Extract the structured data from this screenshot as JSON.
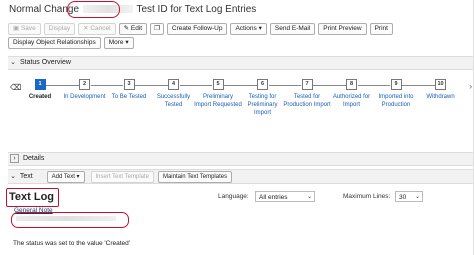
{
  "header": {
    "title_prefix": "Normal Change",
    "title_suffix": "Test ID for Text Log Entries"
  },
  "toolbar": {
    "row1": [
      {
        "label": "Save",
        "icon": "save-icon",
        "enabled": false
      },
      {
        "label": "Display",
        "enabled": false
      },
      {
        "label": "Cancel",
        "icon": "cancel-icon",
        "enabled": false
      },
      {
        "label": "Edit",
        "icon": "edit-icon",
        "enabled": true
      },
      {
        "label": "",
        "icon": "copy-icon",
        "enabled": true
      },
      {
        "label": "Create Follow-Up",
        "enabled": true
      },
      {
        "label": "Actions",
        "dropdown": true,
        "enabled": true
      },
      {
        "label": "Send E-Mail",
        "enabled": true
      },
      {
        "label": "Print Preview",
        "enabled": true
      },
      {
        "label": "Print",
        "enabled": true
      }
    ],
    "row2": [
      {
        "label": "Display Object Relationships",
        "enabled": true
      },
      {
        "label": "More",
        "dropdown": true,
        "enabled": true
      }
    ]
  },
  "status_overview": {
    "title": "Status Overview",
    "steps": [
      {
        "num": "1",
        "label": "Created",
        "active": true
      },
      {
        "num": "2",
        "label": "In Development"
      },
      {
        "num": "3",
        "label": "To Be Tested"
      },
      {
        "num": "4",
        "label": "Successfully Tested"
      },
      {
        "num": "5",
        "label": "Preliminary Import Requested"
      },
      {
        "num": "6",
        "label": "Testing for Preliminary Import"
      },
      {
        "num": "7",
        "label": "Tested for Production Import"
      },
      {
        "num": "8",
        "label": "Authorized for Import"
      },
      {
        "num": "9",
        "label": "Imported into Production"
      },
      {
        "num": "10",
        "label": "Withdrawn"
      }
    ]
  },
  "details": {
    "title": "Details"
  },
  "text_section": {
    "title": "Text",
    "add_text": "Add Text",
    "insert_template": "Insert Text Template",
    "maintain_templates": "Maintain Text Templates"
  },
  "text_log": {
    "title": "Text Log",
    "language_label": "Language:",
    "language_value": "All entries",
    "max_lines_label": "Maximum Lines:",
    "max_lines_value": "30",
    "note_title": "General Note",
    "status_message": "The status was set to the value 'Created'"
  },
  "colors": {
    "accent": "#1b66c9",
    "highlight": "#c8102e",
    "link": "#1a5fb4"
  }
}
